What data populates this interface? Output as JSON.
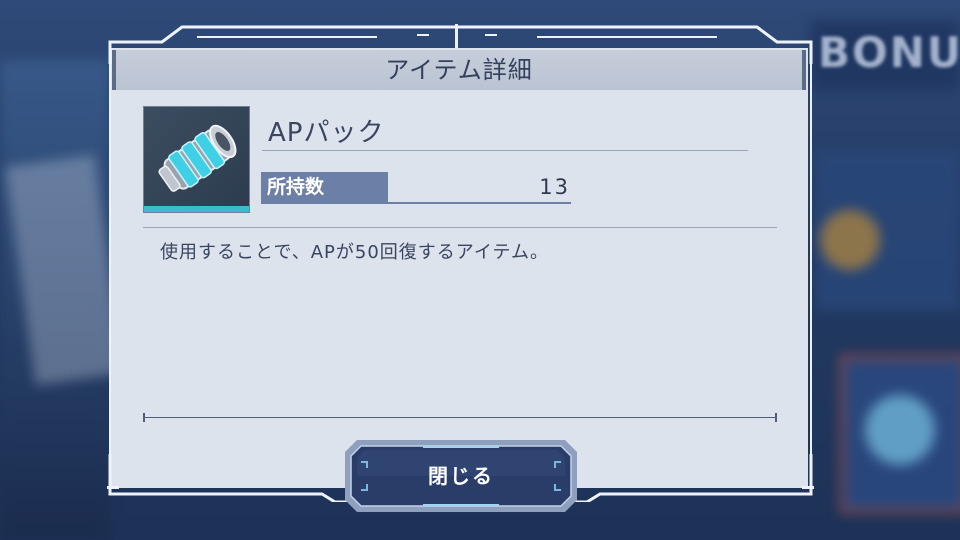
{
  "dialog": {
    "title": "アイテム詳細",
    "item": {
      "name": "APパック",
      "owned_label": "所持数",
      "owned_count": "13",
      "description": "使用することで、APが50回復するアイテム。",
      "icon": "ap-pack-canister-icon"
    },
    "close_label": "閉じる"
  },
  "background": {
    "bonus_text": "BONU"
  },
  "colors": {
    "panel": "#dde3ed",
    "title_bar": "#bac3d2",
    "owned_label_bg": "#6c7fa6",
    "accent_cyan": "#3fd0e6",
    "button_bg": "#2a3c68"
  }
}
